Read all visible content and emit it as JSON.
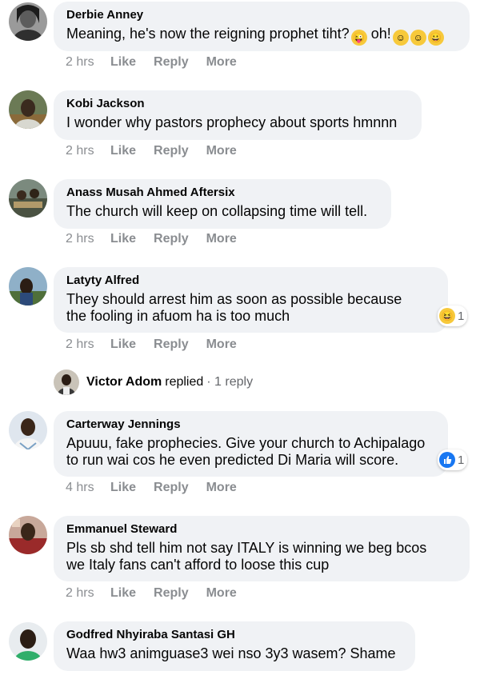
{
  "comments": [
    {
      "author": "Derbie Anney",
      "text": "Meaning, he's now the reigning prophet tiht?",
      "text_tail": "oh!",
      "time": "2 hrs",
      "like": "Like",
      "reply": "Reply",
      "more": "More"
    },
    {
      "author": "Kobi Jackson",
      "text": "I wonder why pastors prophecy about sports hmnnn",
      "time": "2 hrs",
      "like": "Like",
      "reply": "Reply",
      "more": "More"
    },
    {
      "author": "Anass Musah Ahmed Aftersix",
      "text": "The church will keep on collapsing time will tell.",
      "time": "2 hrs",
      "like": "Like",
      "reply": "Reply",
      "more": "More"
    },
    {
      "author": "Latyty Alfred",
      "text_line1": "They should arrest him as soon as possible because",
      "text_line2": "the fooling in afuom ha is too much",
      "reaction_count": "1",
      "time": "2 hrs",
      "like": "Like",
      "reply": "Reply",
      "more": "More"
    },
    {
      "author": "Carterway Jennings",
      "text_line1": "Apuuu, fake prophecies. Give your church to Achipalago",
      "text_line2": "to run wai cos he even predicted Di Maria will score.",
      "reaction_count": "1",
      "time": "4 hrs",
      "like": "Like",
      "reply": "Reply",
      "more": "More"
    },
    {
      "author": "Emmanuel Steward",
      "text_line1": "Pls sb shd tell him not say ITALY is winning we beg bcos",
      "text_line2": "we Italy fans can't afford to loose this cup",
      "time": "2 hrs",
      "like": "Like",
      "reply": "Reply",
      "more": "More"
    },
    {
      "author": "Godfred Nhyiraba Santasi GH",
      "text": "Waa hw3 animguase3 wei nso 3y3 wasem? Shame"
    }
  ],
  "replied": {
    "name": "Victor Adom",
    "verb": "replied",
    "count": "· 1 reply"
  },
  "colors": {
    "bubble": "#f0f2f5",
    "meta": "#8a8d91",
    "like_blue": "#1877f2",
    "haha_yellow": "#f7c93b"
  }
}
